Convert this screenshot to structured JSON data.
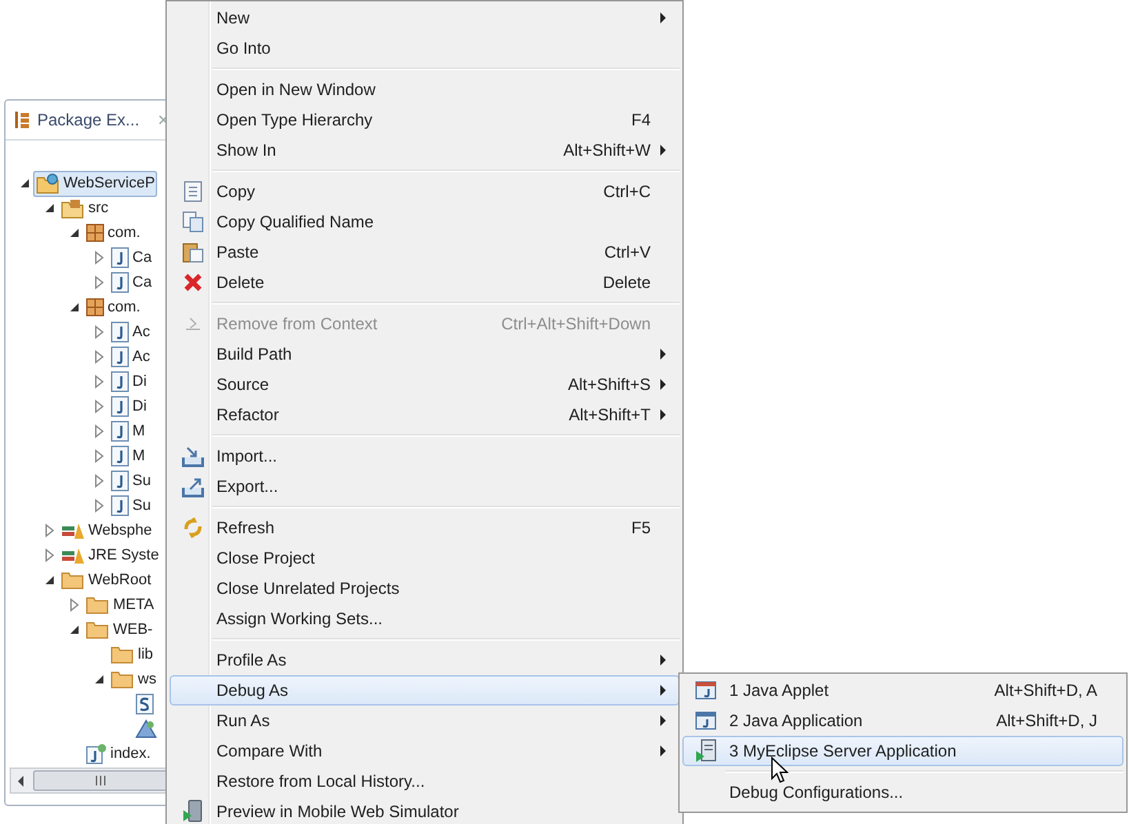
{
  "panel": {
    "title": "Package Ex...",
    "close": "✕"
  },
  "tree": [
    {
      "label": "WebServiceP",
      "kind": "project",
      "expanded": true,
      "selected": true,
      "children": [
        {
          "label": "src",
          "kind": "source-folder",
          "expanded": true,
          "selected": false,
          "children": [
            {
              "label": "com.",
              "kind": "package",
              "expanded": true,
              "selected": false,
              "children": [
                {
                  "label": "Ca",
                  "kind": "java-file",
                  "expanded": false,
                  "selected": false
                },
                {
                  "label": "Ca",
                  "kind": "java-file",
                  "expanded": false,
                  "selected": false
                }
              ]
            },
            {
              "label": "com.",
              "kind": "package",
              "expanded": true,
              "selected": false,
              "children": [
                {
                  "label": "Ac",
                  "kind": "java-file",
                  "expanded": false,
                  "selected": false
                },
                {
                  "label": "Ac",
                  "kind": "java-file",
                  "expanded": false,
                  "selected": false
                },
                {
                  "label": "Di",
                  "kind": "java-file",
                  "expanded": false,
                  "selected": false
                },
                {
                  "label": "Di",
                  "kind": "java-file",
                  "expanded": false,
                  "selected": false
                },
                {
                  "label": "M",
                  "kind": "java-file",
                  "expanded": false,
                  "selected": false
                },
                {
                  "label": "M",
                  "kind": "java-file",
                  "expanded": false,
                  "selected": false
                },
                {
                  "label": "Su",
                  "kind": "java-file",
                  "expanded": false,
                  "selected": false
                },
                {
                  "label": "Su",
                  "kind": "java-file",
                  "expanded": false,
                  "selected": false
                }
              ]
            }
          ]
        },
        {
          "label": "Websphe",
          "kind": "library",
          "expanded": false,
          "selected": false
        },
        {
          "label": "JRE Syste",
          "kind": "library",
          "expanded": false,
          "selected": false
        },
        {
          "label": "WebRoot",
          "kind": "folder",
          "expanded": true,
          "selected": false,
          "children": [
            {
              "label": "META",
              "kind": "folder",
              "expanded": false,
              "selected": false
            },
            {
              "label": "WEB-",
              "kind": "folder",
              "expanded": true,
              "selected": false,
              "children": [
                {
                  "label": "lib",
                  "kind": "folder",
                  "selected": false
                },
                {
                  "label": "ws",
                  "kind": "folder",
                  "expanded": true,
                  "selected": false,
                  "children": [
                    {
                      "kind": "s-file",
                      "selected": false
                    },
                    {
                      "kind": "wsdl-file",
                      "selected": false
                    }
                  ]
                }
              ]
            },
            {
              "label": "index.",
              "kind": "jsp-file",
              "selected": false
            }
          ]
        }
      ]
    }
  ],
  "menu": [
    [
      {
        "label": "New",
        "submenu": true,
        "disabled": false,
        "selected": false
      },
      {
        "label": "Go Into",
        "submenu": false,
        "disabled": false,
        "selected": false
      }
    ],
    [
      {
        "label": "Open in New Window",
        "submenu": false,
        "disabled": false,
        "selected": false
      },
      {
        "label": "Open Type Hierarchy",
        "shortcut": "F4",
        "submenu": false,
        "disabled": false,
        "selected": false
      },
      {
        "label": "Show In",
        "shortcut": "Alt+Shift+W",
        "submenu": true,
        "disabled": false,
        "selected": false
      }
    ],
    [
      {
        "label": "Copy",
        "shortcut": "Ctrl+C",
        "submenu": false,
        "disabled": false,
        "selected": false
      },
      {
        "label": "Copy Qualified Name",
        "submenu": false,
        "disabled": false,
        "selected": false
      },
      {
        "label": "Paste",
        "shortcut": "Ctrl+V",
        "submenu": false,
        "disabled": false,
        "selected": false
      },
      {
        "label": "Delete",
        "shortcut": "Delete",
        "submenu": false,
        "disabled": false,
        "selected": false
      }
    ],
    [
      {
        "label": "Remove from Context",
        "shortcut": "Ctrl+Alt+Shift+Down",
        "submenu": false,
        "disabled": true,
        "selected": false
      },
      {
        "label": "Build Path",
        "submenu": true,
        "disabled": false,
        "selected": false
      },
      {
        "label": "Source",
        "shortcut": "Alt+Shift+S",
        "submenu": true,
        "disabled": false,
        "selected": false
      },
      {
        "label": "Refactor",
        "shortcut": "Alt+Shift+T",
        "submenu": true,
        "disabled": false,
        "selected": false
      }
    ],
    [
      {
        "label": "Import...",
        "submenu": false,
        "disabled": false,
        "selected": false
      },
      {
        "label": "Export...",
        "submenu": false,
        "disabled": false,
        "selected": false
      }
    ],
    [
      {
        "label": "Refresh",
        "shortcut": "F5",
        "submenu": false,
        "disabled": false,
        "selected": false
      },
      {
        "label": "Close Project",
        "submenu": false,
        "disabled": false,
        "selected": false
      },
      {
        "label": "Close Unrelated Projects",
        "submenu": false,
        "disabled": false,
        "selected": false
      },
      {
        "label": "Assign Working Sets...",
        "submenu": false,
        "disabled": false,
        "selected": false
      }
    ],
    [
      {
        "label": "Profile As",
        "submenu": true,
        "disabled": false,
        "selected": false
      },
      {
        "label": "Debug As",
        "submenu": true,
        "disabled": false,
        "selected": true
      },
      {
        "label": "Run As",
        "submenu": true,
        "disabled": false,
        "selected": false
      },
      {
        "label": "Compare With",
        "submenu": true,
        "disabled": false,
        "selected": false
      },
      {
        "label": "Restore from Local History...",
        "submenu": false,
        "disabled": false,
        "selected": false
      },
      {
        "label": "Preview in Mobile Web Simulator",
        "submenu": false,
        "disabled": false,
        "selected": false
      }
    ]
  ],
  "submenu": [
    [
      {
        "label": "1 Java Applet",
        "shortcut": "Alt+Shift+D, A",
        "selected": false
      },
      {
        "label": "2 Java Application",
        "shortcut": "Alt+Shift+D, J",
        "selected": false
      },
      {
        "label": "3 MyEclipse Server Application",
        "selected": true
      }
    ],
    [
      {
        "label": "Debug Configurations...",
        "selected": false
      }
    ]
  ]
}
